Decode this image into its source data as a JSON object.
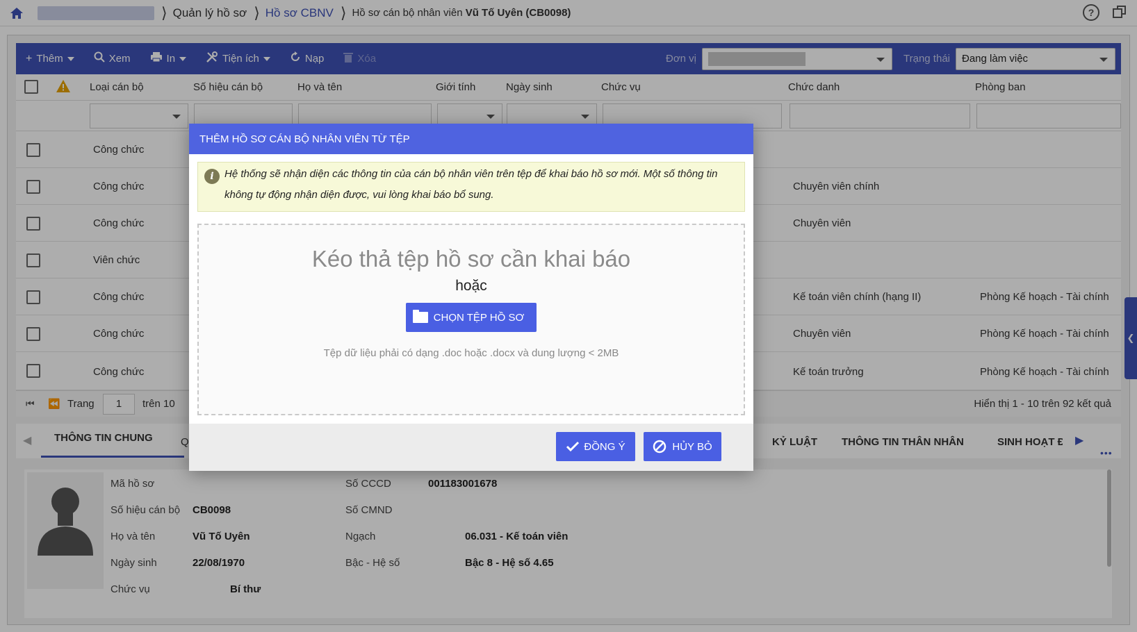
{
  "breadcrumb": {
    "item1": "Quản lý hồ sơ",
    "item2": "Hồ sơ CBNV",
    "current_prefix": "Hồ sơ cán bộ nhân viên ",
    "current_name": "Vũ Tố Uyên (CB0098)"
  },
  "topbar": {
    "help_glyph": "?"
  },
  "toolbar": {
    "add": "Thêm",
    "view": "Xem",
    "print": "In",
    "utility": "Tiện ích",
    "reload": "Nạp",
    "delete": "Xóa",
    "unit_label": "Đơn vị",
    "unit_value": "",
    "status_label": "Trạng thái",
    "status_value": "Đang làm việc"
  },
  "columns": {
    "type": "Loại cán bộ",
    "code": "Số hiệu cán bộ",
    "name": "Họ và tên",
    "gender": "Giới tính",
    "dob": "Ngày sinh",
    "position": "Chức vụ",
    "title": "Chức danh",
    "dept": "Phòng ban"
  },
  "rows": [
    {
      "type": "Công chức",
      "title": "",
      "dept": ""
    },
    {
      "type": "Công chức",
      "title": "Chuyên viên chính",
      "dept": ""
    },
    {
      "type": "Công chức",
      "title": "Chuyên viên",
      "dept": ""
    },
    {
      "type": "Viên chức",
      "title": "",
      "dept": ""
    },
    {
      "type": "Công chức",
      "title": "Kế toán viên chính (hạng II)",
      "dept": "Phòng Kế hoạch - Tài chính"
    },
    {
      "type": "Công chức",
      "title": "Chuyên viên",
      "dept": "Phòng Kế hoạch - Tài chính"
    },
    {
      "type": "Công chức",
      "title": "Kế toán trưởng",
      "dept": "Phòng Kế hoạch - Tài chính"
    }
  ],
  "pager": {
    "page_label": "Trang",
    "page_value": "1",
    "of_label": "trên 10",
    "summary": "Hiển thị 1 - 10 trên 92 kết quả"
  },
  "tabs": {
    "general": "THÔNG TIN CHUNG",
    "partial": "Q",
    "discipline": "KỶ LUẬT",
    "relatives": "THÔNG TIN THÂN NHÂN",
    "activity": "SINH HOẠT Đ"
  },
  "detail": {
    "record_code_label": "Mã hồ sơ",
    "code_label": "Số hiệu cán bộ",
    "code_value": "CB0098",
    "name_label": "Họ và tên",
    "name_value": "Vũ Tố Uyên",
    "dob_label": "Ngày sinh",
    "dob_value": "22/08/1970",
    "position_label": "Chức vụ",
    "position_value": "Bí thư",
    "cccd_label": "Số CCCD",
    "cccd_value": "001183001678",
    "cmnd_label": "Số CMND",
    "rank_label": "Ngạch",
    "rank_value": "06.031 - Kế toán viên",
    "grade_label": "Bậc - Hệ số",
    "grade_value": "Bậc 8 - Hệ số 4.65"
  },
  "modal": {
    "title": "Thêm hồ sơ cán bộ nhân viên từ tệp",
    "info_icon": "i",
    "info": "Hệ thống sẽ nhận diện các thông tin của cán bộ nhân viên trên tệp để khai báo hồ sơ mới. Một số thông tin không tự động nhận diện được, vui lòng khai báo bổ sung.",
    "drop_text": "Kéo thả tệp hồ sơ cần khai báo",
    "or_text": "hoặc",
    "choose_button": "Chọn tệp hồ sơ",
    "hint": "Tệp dữ liệu phải có dạng .doc hoặc .docx và dung lượng < 2MB",
    "ok_button": "Đồng ý",
    "cancel_button": "Hủy bỏ"
  },
  "colors": {
    "primary": "#3f51b5",
    "modal_header": "#4f63e0",
    "info_bg": "#f7f9d8"
  }
}
